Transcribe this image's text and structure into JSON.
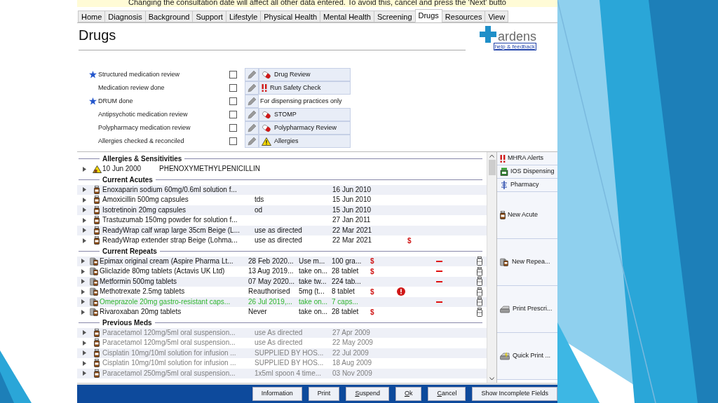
{
  "banner": {
    "text": "Changing the consultation date will affect all other data entered. To avoid this, cancel and press the 'Next' butto"
  },
  "tabs": [
    {
      "label": "Home",
      "selected": false
    },
    {
      "label": "Diagnosis",
      "selected": false
    },
    {
      "label": "Background",
      "selected": false
    },
    {
      "label": "Support",
      "selected": false
    },
    {
      "label": "Lifestyle",
      "selected": false
    },
    {
      "label": "Physical Health",
      "selected": false
    },
    {
      "label": "Mental Health",
      "selected": false
    },
    {
      "label": "Screening",
      "selected": false
    },
    {
      "label": "Drugs",
      "selected": true
    },
    {
      "label": "Resources",
      "selected": false
    },
    {
      "label": "View",
      "selected": false
    }
  ],
  "page": {
    "title": "Drugs",
    "logo": "ardens",
    "help_link": "help & feedback"
  },
  "checklist": [
    {
      "label": "Structured medication review",
      "starred": true,
      "checked": false,
      "action": {
        "kind": "pill",
        "label": "Drug Review"
      }
    },
    {
      "label": "Medication review done",
      "starred": false,
      "checked": false,
      "action": {
        "kind": "alert",
        "label": "Run Safety Check"
      }
    },
    {
      "label": "DRUM done",
      "starred": true,
      "checked": false,
      "action": {
        "kind": "text",
        "label": "For dispensing practices only"
      }
    },
    {
      "label": "Antipsychotic medication review",
      "starred": false,
      "checked": false,
      "action": {
        "kind": "pill",
        "label": "STOMP"
      }
    },
    {
      "label": "Polypharmacy medication review",
      "starred": false,
      "checked": false,
      "action": {
        "kind": "pill",
        "label": "Polypharmacy Review"
      }
    },
    {
      "label": "Allergies checked & reconciled",
      "starred": false,
      "checked": false,
      "action": {
        "kind": "warning",
        "label": "Allergies"
      }
    }
  ],
  "sections": [
    {
      "title": "Allergies & Sensitivities",
      "kind": "allergy",
      "rows": [
        {
          "cells": [
            "10 Jun 2000",
            "PHENOXYMETHYLPENICILLIN"
          ]
        }
      ]
    },
    {
      "title": "Current Acutes",
      "kind": "acute",
      "rows": [
        {
          "cells": [
            "Enoxaparin sodium 60mg/0.6ml solution f...",
            "",
            "16 Jun 2010"
          ]
        },
        {
          "cells": [
            "Amoxicillin 500mg capsules",
            "tds",
            "15 Jun 2010"
          ]
        },
        {
          "cells": [
            "Isotretinoin 20mg capsules",
            "od",
            "15 Jun 2010"
          ]
        },
        {
          "cells": [
            "Trastuzumab 150mg powder for solution f...",
            "",
            "27 Jan 2011"
          ]
        },
        {
          "cells": [
            "ReadyWrap calf wrap large 35cm Beige (L...",
            "use as directed",
            "22 Mar 2021"
          ]
        },
        {
          "cells": [
            "ReadyWrap extender strap Beige (Lohma...",
            "use as directed",
            "22 Mar 2021"
          ],
          "cost": "$"
        }
      ]
    },
    {
      "title": "Current Repeats",
      "kind": "repeat",
      "rows": [
        {
          "cells": [
            "Epimax original cream (Aspire Pharma Lt...",
            "28 Feb 2020...",
            "Use m...",
            "100 gra..."
          ],
          "cost": "$",
          "highlighted": false,
          "alert": false,
          "dash": true
        },
        {
          "cells": [
            "Gliclazide 80mg tablets (Actavis UK Ltd)",
            "13 Aug 2019...",
            "take on...",
            "28 tablet"
          ],
          "cost": "$",
          "highlighted": false,
          "alert": false,
          "dash": true
        },
        {
          "cells": [
            "Metformin 500mg tablets",
            "07 May 2020...",
            "take tw...",
            "224 tab..."
          ],
          "highlighted": false,
          "alert": false,
          "dash": true
        },
        {
          "cells": [
            "Methotrexate 2.5mg tablets",
            "Reauthorised",
            "5mg (t...",
            "8 tablet"
          ],
          "cost": "$",
          "highlighted": false,
          "alert": true,
          "dash": false
        },
        {
          "cells": [
            "Omeprazole 20mg gastro-resistant caps...",
            "26 Jul 2019,...",
            "take on...",
            "7 caps..."
          ],
          "highlighted": true,
          "alert": false,
          "dash": true
        },
        {
          "cells": [
            "Rivaroxaban 20mg tablets",
            "Never",
            "take on...",
            "28 tablet"
          ],
          "cost": "$",
          "highlighted": false,
          "alert": false,
          "dash": false
        }
      ]
    },
    {
      "title": "Previous Meds",
      "kind": "previous",
      "rows": [
        {
          "cells": [
            "Paracetamol 120mg/5ml oral suspension...",
            "use As directed",
            "27 Apr 2009"
          ]
        },
        {
          "cells": [
            "Paracetamol 120mg/5ml oral suspension...",
            "use As directed",
            "22 May 2009"
          ]
        },
        {
          "cells": [
            "Cisplatin 10mg/10ml solution for infusion ...",
            "SUPPLIED BY HOS...",
            "22 Jul 2009"
          ]
        },
        {
          "cells": [
            "Cisplatin 10mg/10ml solution for infusion ...",
            "SUPPLIED BY HOS...",
            "18 Aug 2009"
          ]
        },
        {
          "cells": [
            "Paracetamol 250mg/5ml oral suspension...",
            "1x5ml spoon 4 time...",
            "03 Nov 2009"
          ]
        }
      ]
    }
  ],
  "side_buttons": [
    {
      "kind": "alert",
      "label": "MHRA Alerts"
    },
    {
      "kind": "dispensing",
      "label": "IOS Dispensing"
    },
    {
      "kind": "pharmacy",
      "label": "Pharmacy"
    },
    {
      "kind": "acute",
      "label": "New Acute"
    },
    {
      "kind": "repeat",
      "label": "New Repea..."
    },
    {
      "kind": "print",
      "label": "Print Prescri..."
    },
    {
      "kind": "quickprint",
      "label": "Quick Print ..."
    }
  ],
  "footer_buttons": [
    {
      "label": "Information",
      "mnemonic": false
    },
    {
      "label": "Print",
      "mnemonic": false
    },
    {
      "label": "Suspend",
      "mnemonic": true
    },
    {
      "label": "Ok",
      "mnemonic": true
    },
    {
      "label": "Cancel",
      "mnemonic": true
    },
    {
      "label": "Show Incomplete Fields",
      "mnemonic": false
    }
  ]
}
